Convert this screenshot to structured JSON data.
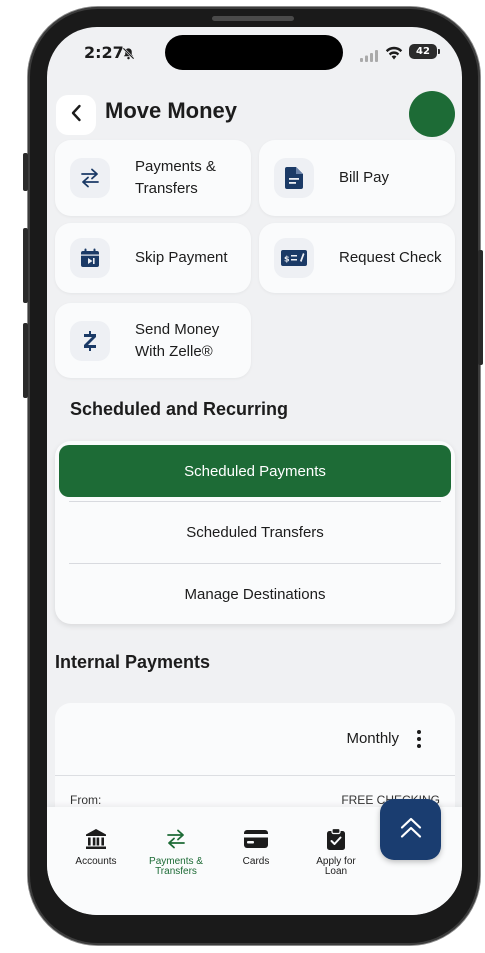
{
  "status_bar": {
    "time": "2:27",
    "battery": "42"
  },
  "header": {
    "title": "Move Money"
  },
  "actions": [
    {
      "label_line1": "Payments &",
      "label_line2": "Transfers",
      "icon": "arrows-swap-icon"
    },
    {
      "label": "Bill Pay",
      "icon": "document-icon"
    },
    {
      "label": "Skip Payment",
      "icon": "calendar-skip-icon"
    },
    {
      "label": "Request Check",
      "icon": "check-request-icon"
    },
    {
      "label_line1": "Send Money",
      "label_line2": "With Zelle®",
      "icon": "zelle-icon"
    }
  ],
  "scheduled": {
    "title": "Scheduled and Recurring",
    "items": [
      "Scheduled Payments",
      "Scheduled Transfers",
      "Manage Destinations"
    ]
  },
  "internal": {
    "title": "Internal Payments",
    "frequency": "Monthly",
    "from_label": "From:",
    "from_value": "FREE CHECKING"
  },
  "nav": {
    "items": [
      {
        "label_line1": "Accounts",
        "label_line2": "",
        "icon": "bank-icon"
      },
      {
        "label_line1": "Payments &",
        "label_line2": "Transfers",
        "icon": "arrows-swap-icon"
      },
      {
        "label_line1": "Cards",
        "label_line2": "",
        "icon": "card-icon"
      },
      {
        "label_line1": "Apply for",
        "label_line2": "Loan",
        "icon": "clipboard-check-icon"
      }
    ]
  },
  "colors": {
    "brand_green": "#1d6b36",
    "navy": "#1a3d70",
    "icon_navy": "#1b3a66",
    "background": "#f0f1f3"
  }
}
